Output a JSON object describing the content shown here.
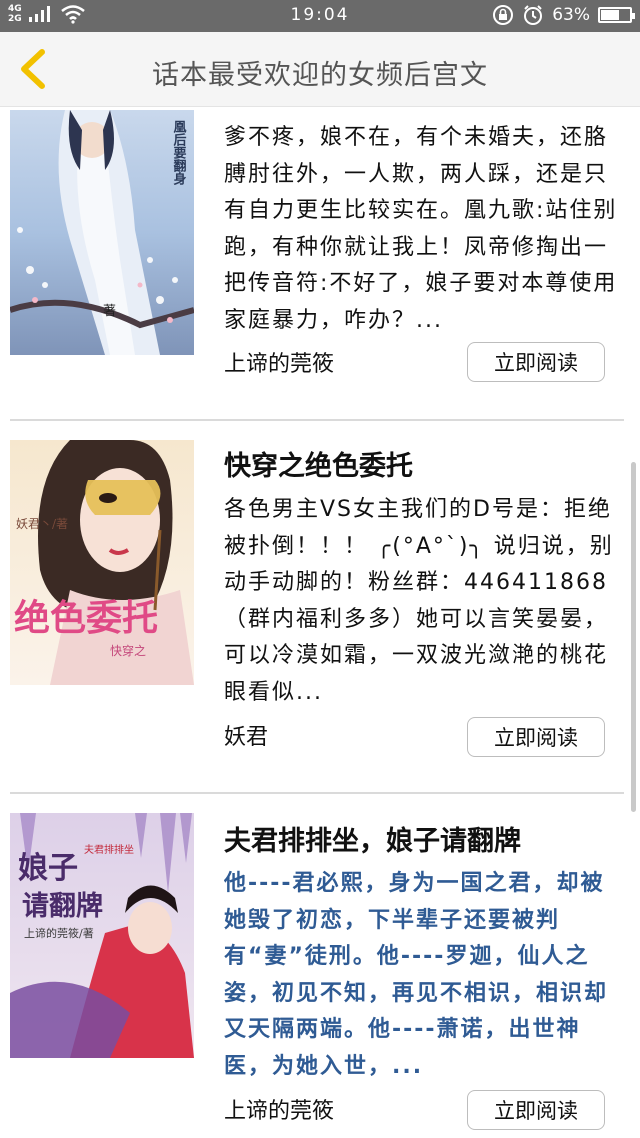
{
  "status_bar": {
    "network_top": "4G",
    "network_bottom": "2G",
    "time": "19:04",
    "battery_percent": "63%",
    "battery_level": 0.63
  },
  "header": {
    "title": "话本最受欢迎的女频后宫文",
    "back_icon": "chevron-left-icon",
    "accent_color": "#f2c100"
  },
  "books": [
    {
      "title": "",
      "description": "爹不疼，娘不在，有个未婚夫，还胳膊肘往外，一人欺，两人踩，还是只有自力更生比较实在。凰九歌:站住别跑，有种你就让我上！凤帝修掏出一把传音符:不好了，娘子要对本尊使用家庭暴力，咋办？...",
      "author": "上谛的莞筱",
      "button": "立即阅读",
      "cover_text": [
        "凰后要翻身",
        "著"
      ]
    },
    {
      "title": "快穿之绝色委托",
      "description": "各色男主VS女主我们的D号是：拒绝被扑倒！！！ ╭(°A°`)╮ 说归说，别动手动脚的！粉丝群：446411868（群内福利多多）她可以言笑晏晏，可以冷漠如霜，一双波光潋滟的桃花眼看似...",
      "author": "妖君",
      "button": "立即阅读",
      "cover_text": [
        "妖君丶/著",
        "绝色委托",
        "快穿之"
      ]
    },
    {
      "title": "夫君排排坐，娘子请翻牌",
      "description": "他----君必熙，身为一国之君，却被她毁了初恋，下半辈子还要被判有“妻”徒刑。他----罗迦，仙人之姿，初见不知，再见不相识，相识却又天隔两端。他----萧诺，出世神医，为她入世，...",
      "author": "上谛的莞筱",
      "button": "立即阅读",
      "cover_text": [
        "娘子",
        "请翻牌",
        "夫君排排坐",
        "上谛的莞筱/著"
      ]
    }
  ]
}
